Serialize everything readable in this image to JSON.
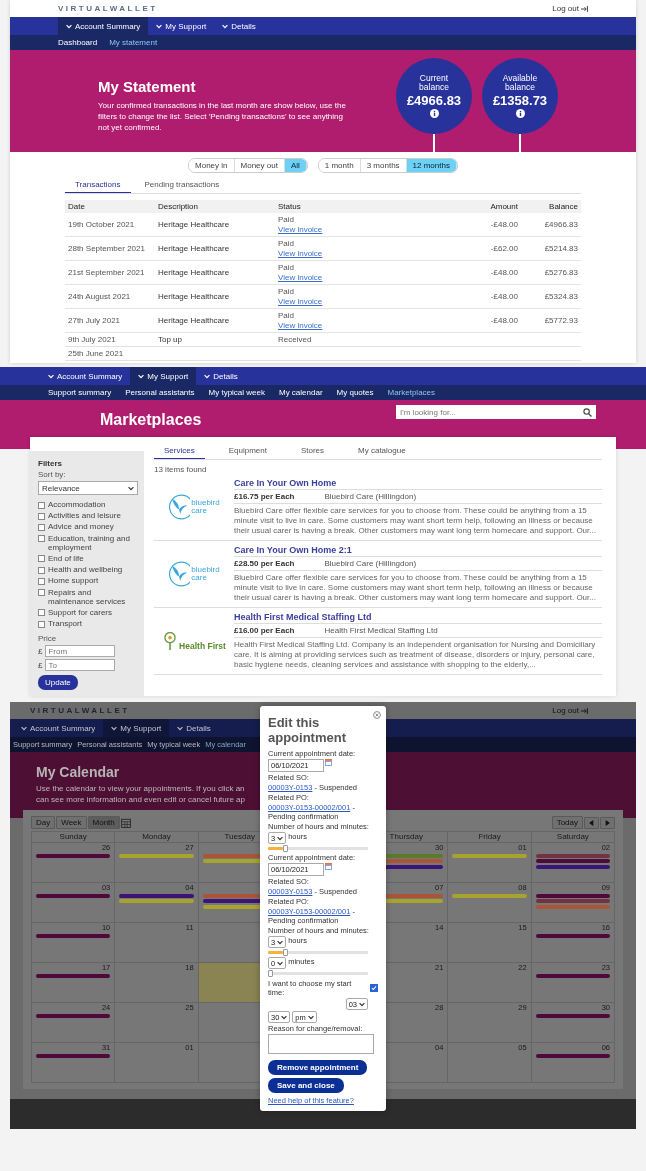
{
  "statement": {
    "logo": "VIRTUALWALLET",
    "logout": "Log out",
    "nav": [
      {
        "label": "Account Summary",
        "selected": true
      },
      {
        "label": "My Support",
        "selected": false
      },
      {
        "label": "Details",
        "selected": false
      }
    ],
    "subnav": [
      {
        "label": "Dashboard",
        "selected": false
      },
      {
        "label": "My statement",
        "selected": true
      }
    ],
    "title": "My Statement",
    "description": "Your confirmed transactions in the last month are show below, use the filters to change the list. Select 'Pending transactions' to see anything not yet confirmed.",
    "balances": [
      {
        "label": "Current balance",
        "amount": "£4966.83"
      },
      {
        "label": "Available balance",
        "amount": "£1358.73"
      }
    ],
    "type_filter": [
      {
        "label": "Money in",
        "selected": false
      },
      {
        "label": "Money out",
        "selected": false
      },
      {
        "label": "All",
        "selected": true
      }
    ],
    "period_filter": [
      {
        "label": "1 month",
        "selected": false
      },
      {
        "label": "3 months",
        "selected": false
      },
      {
        "label": "12 months",
        "selected": true
      }
    ],
    "tabs": [
      {
        "label": "Transactions",
        "selected": true
      },
      {
        "label": "Pending transactions",
        "selected": false
      }
    ],
    "table": {
      "columns": [
        "Date",
        "Description",
        "Status",
        "Amount",
        "Balance"
      ],
      "rows": [
        {
          "date": "19th October 2021",
          "description": "Heritage Healthcare",
          "status": "Paid",
          "link": "View invoice",
          "amount": "-£48.00",
          "balance": "£4966.83"
        },
        {
          "date": "28th September 2021",
          "description": "Heritage Healthcare",
          "status": "Paid",
          "link": "View invoice",
          "amount": "-£62.00",
          "balance": "£5214.83"
        },
        {
          "date": "21st September 2021",
          "description": "Heritage Healthcare",
          "status": "Paid",
          "link": "View invoice",
          "amount": "-£48.00",
          "balance": "£5276.83"
        },
        {
          "date": "24th August 2021",
          "description": "Heritage Healthcare",
          "status": "Paid",
          "link": "View invoice",
          "amount": "-£48.00",
          "balance": "£5324.83"
        },
        {
          "date": "27th July 2021",
          "description": "Heritage Healthcare",
          "status": "Paid",
          "link": "View invoice",
          "amount": "-£48.00",
          "balance": "£5772.93"
        },
        {
          "date": "9th July 2021",
          "description": "Top up",
          "status": "Received"
        },
        {
          "date": "25th June 2021"
        }
      ]
    }
  },
  "marketplace": {
    "nav": [
      {
        "label": "Account Summary",
        "selected": false
      },
      {
        "label": "My Support",
        "selected": true
      },
      {
        "label": "Details",
        "selected": false
      }
    ],
    "subnav": [
      {
        "label": "Support summary",
        "selected": false
      },
      {
        "label": "Personal assistants",
        "selected": false
      },
      {
        "label": "My typical week",
        "selected": false
      },
      {
        "label": "My calendar",
        "selected": false
      },
      {
        "label": "My quotes",
        "selected": false
      },
      {
        "label": "Marketplaces",
        "selected": true
      }
    ],
    "search": {
      "placeholder": "I'm looking for..."
    },
    "title": "Marketplaces",
    "tabs": [
      {
        "label": "Services",
        "selected": true
      },
      {
        "label": "Equipment",
        "selected": false
      },
      {
        "label": "Stores",
        "selected": false
      },
      {
        "label": "My catalogue",
        "selected": false
      }
    ],
    "filters": {
      "title": "Filters",
      "sort_label": "Sort by:",
      "sort_value": "Relevance",
      "categories": [
        {
          "label": "Accommodation",
          "checked": false
        },
        {
          "label": "Activities and leisure",
          "checked": false
        },
        {
          "label": "Advice and money",
          "checked": false
        },
        {
          "label": "Education, training and employment",
          "checked": false
        },
        {
          "label": "End of life",
          "checked": false
        },
        {
          "label": "Health and wellbeing",
          "checked": false
        },
        {
          "label": "Home support",
          "checked": false
        },
        {
          "label": "Repairs and maintenance services",
          "checked": false
        },
        {
          "label": "Support for carers",
          "checked": false
        },
        {
          "label": "Transport",
          "checked": false
        }
      ],
      "price_label": "Price",
      "price_fields": [
        {
          "currency": "£",
          "placeholder": "From"
        },
        {
          "currency": "£",
          "placeholder": "To"
        }
      ],
      "update": "Update"
    },
    "count": "13 items found",
    "items": [
      {
        "title": "Care In Your Own Home",
        "price": "£16.75 per Each",
        "provider": "Bluebird Care (Hillingdon)",
        "description": "Bluebird Care offer flexible care services for you to choose from. These could be anything from a 15 minute visit to live in care. Some customers may want short term help, following an illness or because their usual carer is having a break. Other customers may want long term homecare and support. Our...",
        "logo": {
          "kind": "bird",
          "lines": [
            "bluebird",
            "care"
          ]
        }
      },
      {
        "title": "Care In Your Own Home 2:1",
        "price": "£28.50 per Each",
        "provider": "Bluebird Care (Hillingdon)",
        "description": "Bluebird Care offer flexible care services for you to choose from. These could be anything from a 15 minute visit to live in care. Some customers may want short term help, following an illness or because their usual carer is having a break. Other customers may want long term homecare and support. Our...",
        "logo": {
          "kind": "bird",
          "lines": [
            "bluebird",
            "care"
          ]
        }
      },
      {
        "title": "Health First Medical Staffing Ltd",
        "price": "£16.00 per Each",
        "provider": "Health First Medical Staffing Ltd",
        "description": "Health First Medical Staffing Ltd. Company is an independent organisation for Nursing and Domiciliary care. It is aiming at providing services such as treatment of disease, disorders or injury, personal care, basic hygiene needs, cleaning services and assistance with shopping to the elderly,...",
        "logo": {
          "kind": "tree",
          "lines": [
            "Health First"
          ]
        }
      }
    ]
  },
  "calendar": {
    "logo": "VIRTUALWALLET",
    "logout": "Log out",
    "nav": [
      {
        "label": "Account Summary",
        "selected": false
      },
      {
        "label": "My Support",
        "selected": true
      },
      {
        "label": "Details",
        "selected": false
      }
    ],
    "subnav": [
      {
        "label": "Support summary",
        "selected": false
      },
      {
        "label": "Personal assistants",
        "selected": false
      },
      {
        "label": "My typical week",
        "selected": false
      },
      {
        "label": "My calendar",
        "selected": true
      }
    ],
    "title": "My Calendar",
    "description": [
      "Use the calendar to view your appointments. If you click an",
      "can see more information and even edit or cancel future ap"
    ],
    "views": [
      {
        "label": "Day",
        "selected": false
      },
      {
        "label": "Week",
        "selected": false
      },
      {
        "label": "Month",
        "selected": true
      }
    ],
    "today": "Today",
    "weekdays_left": [
      "Sunday",
      "Monday",
      "Tuesday"
    ],
    "weekdays_right": [
      "Thursday",
      "Friday",
      "Saturday"
    ],
    "weeks": [
      {
        "left": [
          {
            "date": "26",
            "highlighted": false,
            "bars": [
              {
                "color": "#4f0a3c"
              }
            ]
          },
          {
            "date": "27",
            "highlighted": false,
            "bars": [
              {
                "color": "#a8a22e"
              }
            ]
          },
          {
            "highlighted": false,
            "bars": [
              {
                "color": "#a8553a"
              },
              {
                "color": "#a8a22e"
              }
            ]
          }
        ],
        "right": [
          {
            "date": "30",
            "highlighted": false,
            "bars": [
              {
                "color": "#5c7a2c"
              },
              {
                "color": "#a8553a"
              },
              {
                "color": "#3a1477"
              }
            ]
          },
          {
            "date": "01",
            "highlighted": false,
            "bars": [
              {
                "color": "#a8a22e"
              }
            ]
          },
          {
            "date": "02",
            "highlighted": false,
            "bars": [
              {
                "color": "#6e3540"
              },
              {
                "color": "#4f0a3c"
              },
              {
                "color": "#3a1477"
              }
            ]
          }
        ]
      },
      {
        "left": [
          {
            "date": "03",
            "highlighted": false,
            "bars": [
              {
                "color": "#4f0a3c"
              }
            ]
          },
          {
            "date": "04",
            "highlighted": false,
            "bars": [
              {
                "color": "#3a1477"
              },
              {
                "color": "#a8a22e"
              }
            ]
          },
          {
            "highlighted": false,
            "bars": [
              {
                "color": "#a8553a"
              },
              {
                "color": "#3a1477"
              },
              {
                "color": "#a8a22e"
              }
            ]
          }
        ],
        "right": [
          {
            "date": "07",
            "highlighted": false,
            "bars": [
              {
                "color": "#a8553a"
              },
              {
                "color": "#a8a22e"
              }
            ]
          },
          {
            "date": "08",
            "highlighted": false,
            "bars": [
              {
                "color": "#a8a22e"
              }
            ]
          },
          {
            "date": "09",
            "highlighted": false,
            "bars": [
              {
                "color": "#4f0a3c"
              },
              {
                "color": "#6e3540"
              },
              {
                "color": "#a8553a"
              }
            ]
          }
        ]
      },
      {
        "left": [
          {
            "date": "10",
            "highlighted": false,
            "bars": [
              {
                "color": "#4f0a3c"
              }
            ]
          },
          {
            "date": "11",
            "highlighted": false
          },
          {
            "highlighted": false
          }
        ],
        "right": [
          {
            "date": "14",
            "highlighted": false
          },
          {
            "date": "15",
            "highlighted": false
          },
          {
            "date": "16",
            "highlighted": false,
            "bars": [
              {
                "color": "#4f0a3c"
              }
            ]
          }
        ]
      },
      {
        "left": [
          {
            "date": "17",
            "highlighted": false,
            "bars": [
              {
                "color": "#4f0a3c"
              }
            ]
          },
          {
            "date": "18",
            "highlighted": false
          },
          {
            "highlighted": true
          }
        ],
        "right": [
          {
            "date": "21",
            "highlighted": false
          },
          {
            "date": "22",
            "highlighted": false
          },
          {
            "date": "23",
            "highlighted": false,
            "bars": [
              {
                "color": "#4f0a3c"
              }
            ]
          }
        ]
      },
      {
        "left": [
          {
            "date": "24",
            "highlighted": false,
            "bars": [
              {
                "color": "#4f0a3c"
              }
            ]
          },
          {
            "date": "25",
            "highlighted": false
          },
          {
            "highlighted": false
          }
        ],
        "right": [
          {
            "date": "28",
            "highlighted": false
          },
          {
            "date": "29",
            "highlighted": false
          },
          {
            "date": "30",
            "highlighted": false,
            "bars": [
              {
                "color": "#4f0a3c"
              }
            ]
          }
        ]
      },
      {
        "left": [
          {
            "date": "31",
            "highlighted": false,
            "bars": [
              {
                "color": "#4f0a3c"
              }
            ]
          },
          {
            "date": "01",
            "highlighted": false
          },
          {
            "highlighted": false
          }
        ],
        "right": [
          {
            "date": "04",
            "highlighted": false
          },
          {
            "date": "05",
            "highlighted": false
          },
          {
            "date": "06",
            "highlighted": false,
            "bars": [
              {
                "color": "#4f0a3c"
              }
            ]
          }
        ]
      }
    ],
    "modal": {
      "title": "Edit this appointment",
      "appointments": [
        {
          "date_label": "Current appointment date:",
          "date": "06/10/2021",
          "so_label": "Related SO:",
          "so_link": "00003Y-0153",
          "so_status": "- Suspended",
          "po_label": "Related PO:",
          "po_link": "00003Y-0153-00002/001",
          "po_status": "- Pending confirmation",
          "duration_label": "Number of hours and minutes:",
          "durations": [
            {
              "value": "3",
              "unit": "hours",
              "level": 0.15
            }
          ]
        },
        {
          "date_label": "Current appointment date:",
          "date": "06/10/2021",
          "so_label": "Related SO:",
          "so_link": "00003Y-0153",
          "so_status": "- Suspended",
          "po_label": "Related PO:",
          "po_link": "00003Y-0153-00002/001",
          "po_status": "- Pending confirmation",
          "duration_label": "Number of hours and minutes:",
          "durations": [
            {
              "value": "3",
              "unit": "hours",
              "level": 0.15
            },
            {
              "value": "0",
              "unit": "minutes",
              "level": 0
            }
          ]
        }
      ],
      "start_time": {
        "label": "I want to choose my start time:",
        "checked": true,
        "hour": "03",
        "minute": "30",
        "period": "pm"
      },
      "reason_label": "Reason for change/removal:",
      "buttons": [
        "Remove appointment",
        "Save and close"
      ],
      "help": "Need help of this feature?"
    }
  }
}
